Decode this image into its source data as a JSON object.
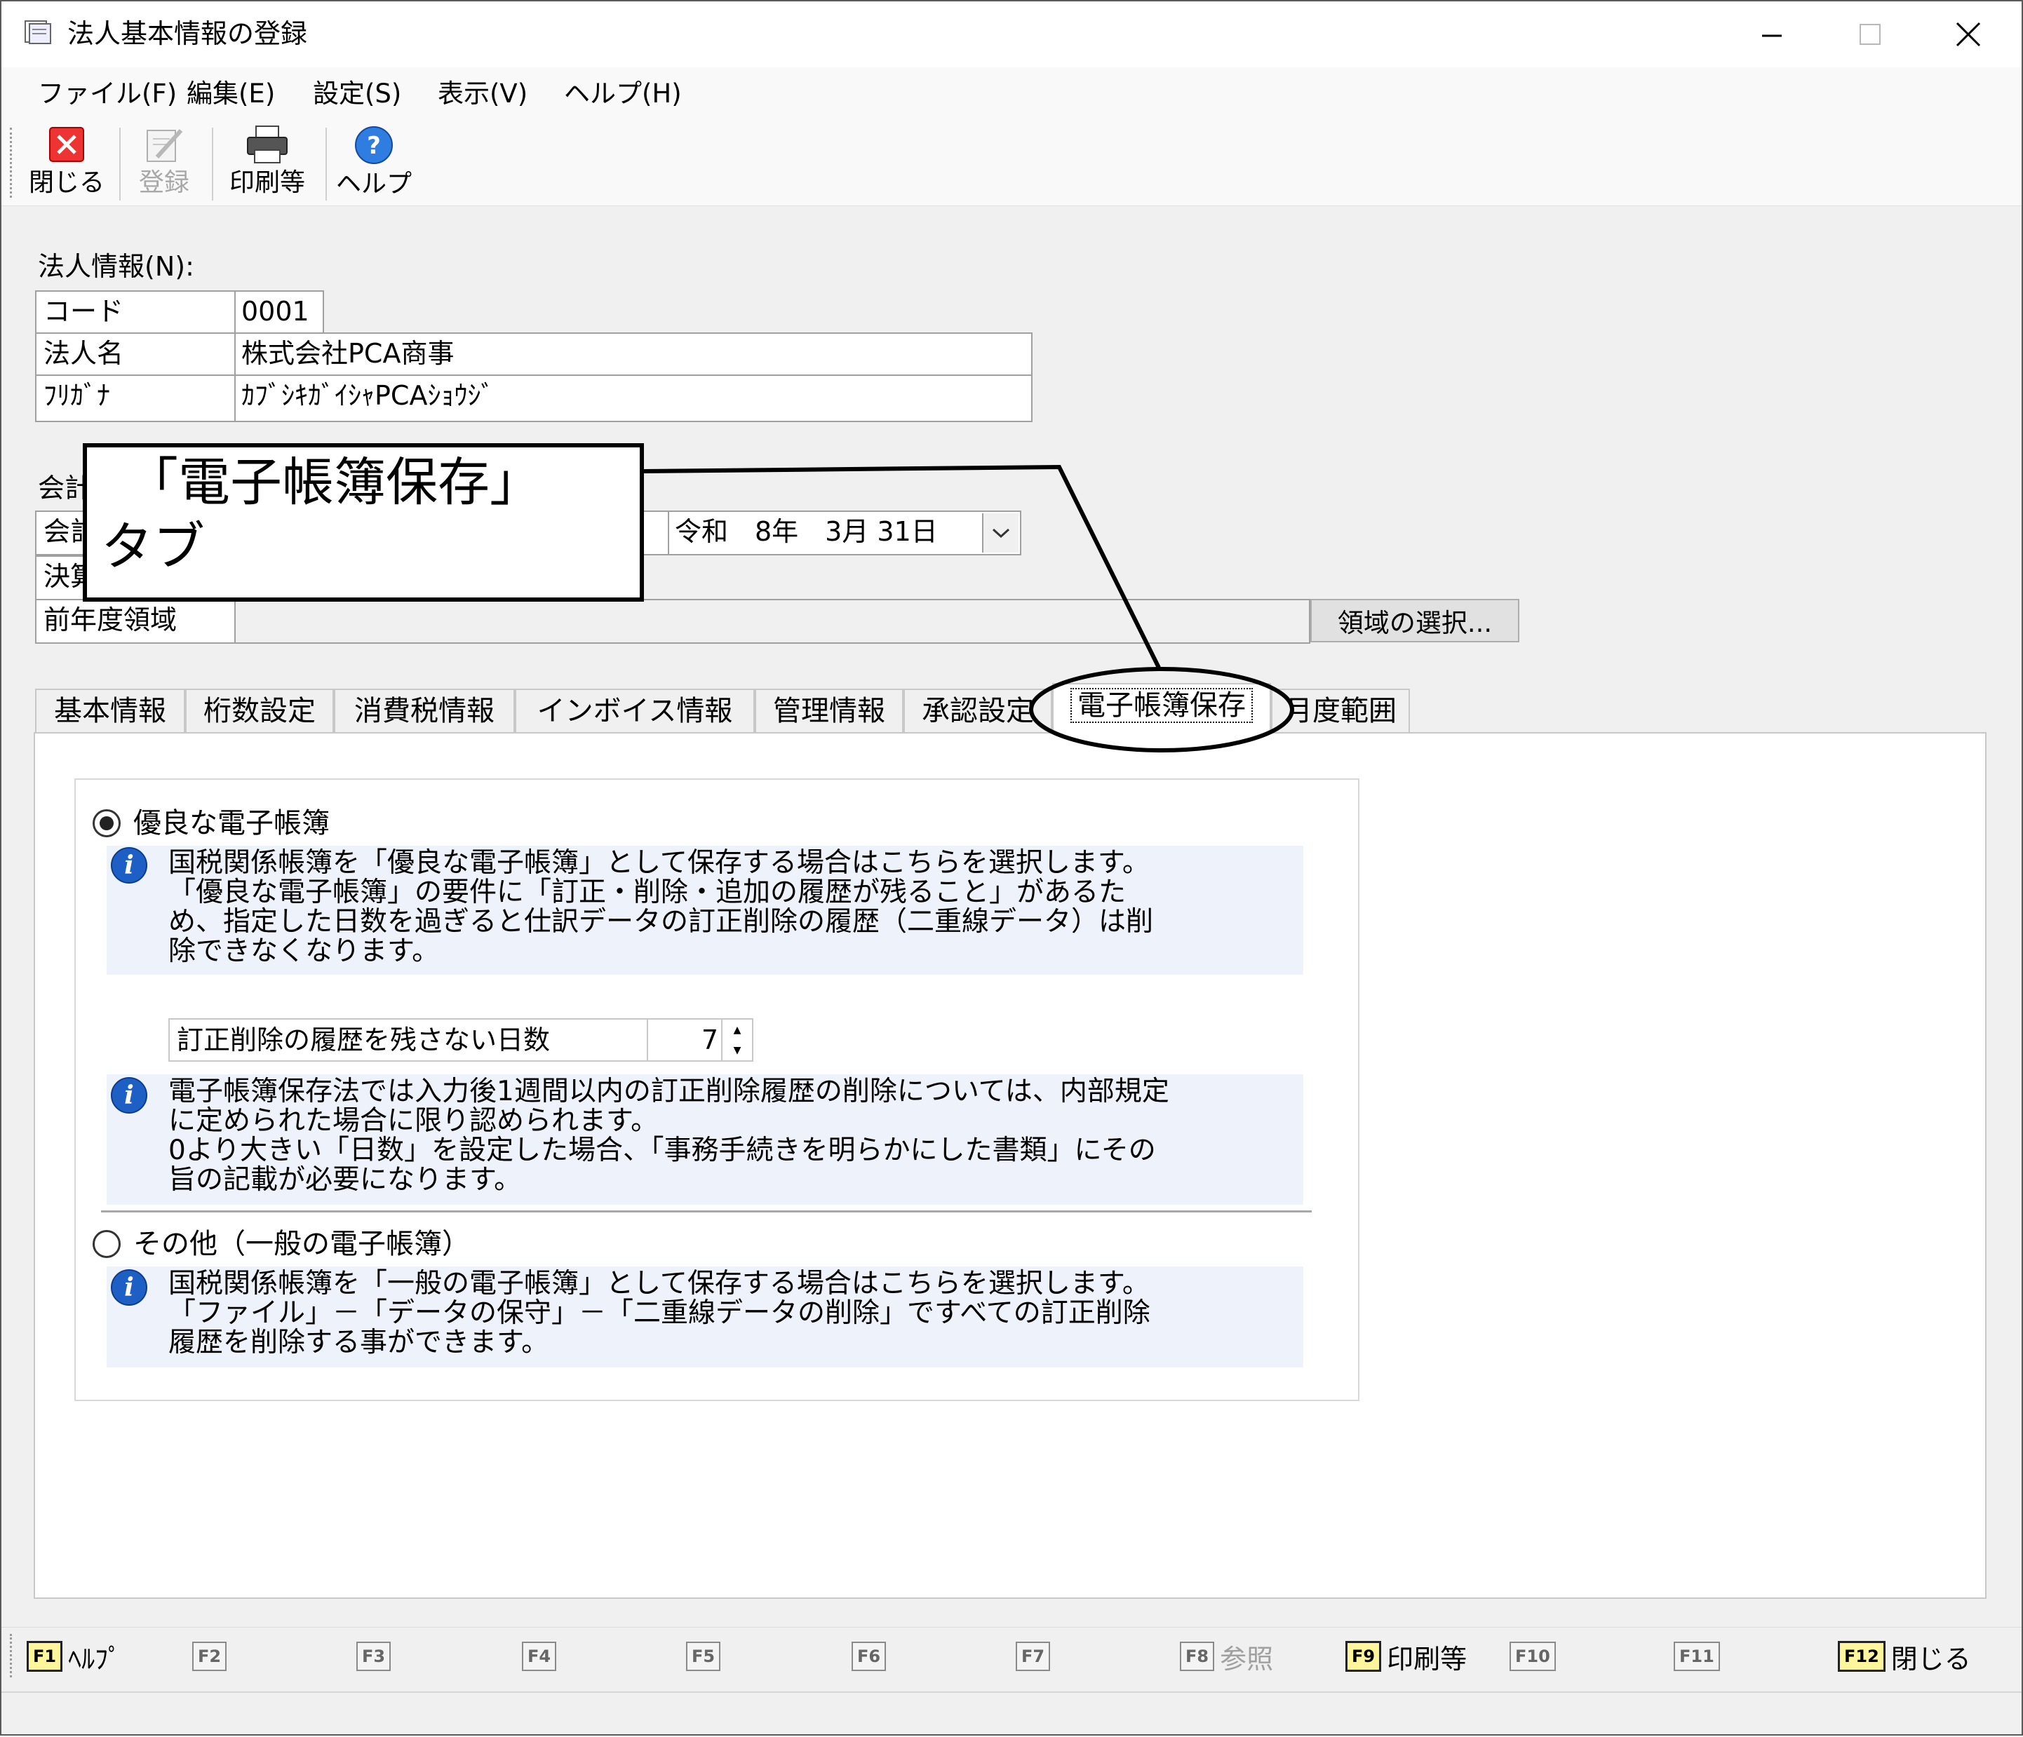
{
  "window": {
    "title": "法人基本情報の登録"
  },
  "menu": [
    "ファイル(F)",
    "編集(E)",
    "設定(S)",
    "表示(V)",
    "ヘルプ(H)"
  ],
  "toolbar": {
    "close": "閉じる",
    "register": "登録",
    "print": "印刷等",
    "help": "ヘルプ"
  },
  "corp": {
    "section_label": "法人情報(N):",
    "code_label": "コード",
    "code": "0001",
    "name_label": "法人名",
    "name": "株式会社PCA商事",
    "kana_label": "ﾌﾘｶﾞﾅ",
    "kana": "ｶﾌﾞｼｷｶﾞｲｼｬPCAｼｮｳｼﾞ"
  },
  "period": {
    "section_label_partial": "会計",
    "row1_label_partial": "会計",
    "row2_label_partial": "決算",
    "end_date": "令和　8年　3月 31日",
    "prev_label": "前年度領域",
    "prev_value": "",
    "select_button": "領域の選択..."
  },
  "callout": {
    "line1": "「電子帳簿保存」",
    "line2": "タブ"
  },
  "tabs": [
    "基本情報",
    "桁数設定",
    "消費税情報",
    "インボイス情報",
    "管理情報",
    "承認設定",
    "電子帳簿保存",
    "月度範囲"
  ],
  "active_tab": "電子帳簿保存",
  "ebook": {
    "option1_label": "優良な電子帳簿",
    "option1_selected": true,
    "info1": "国税関係帳簿を「優良な電子帳簿」として保存する場合はこちらを選択します。\n「優良な電子帳簿」の要件に「訂正・削除・追加の履歴が残ること」があるた\nめ、指定した日数を過ぎると仕訳データの訂正削除の履歴（二重線データ）は削\n除できなくなります。",
    "days_label": "訂正削除の履歴を残さない日数",
    "days_value": "7",
    "info2": "電子帳簿保存法では入力後1週間以内の訂正削除履歴の削除については、内部規定\nに定められた場合に限り認められます。\n0より大きい「日数」を設定した場合、「事務手続きを明らかにした書類」にその\n旨の記載が必要になります。",
    "option2_label": "その他（一般の電子帳簿）",
    "option2_selected": false,
    "info3": "国税関係帳簿を「一般の電子帳簿」として保存する場合はこちらを選択します。\n「ファイル」－「データの保守」－「二重線データの削除」ですべての訂正削除\n履歴を削除する事ができます。"
  },
  "fkeys": [
    {
      "key": "F1",
      "label": "ﾍﾙﾌﾟ",
      "enabled": true
    },
    {
      "key": "F2",
      "label": "",
      "enabled": false
    },
    {
      "key": "F3",
      "label": "",
      "enabled": false
    },
    {
      "key": "F4",
      "label": "",
      "enabled": false
    },
    {
      "key": "F5",
      "label": "",
      "enabled": false
    },
    {
      "key": "F6",
      "label": "",
      "enabled": false
    },
    {
      "key": "F7",
      "label": "",
      "enabled": false
    },
    {
      "key": "F8",
      "label": "参照",
      "enabled": false
    },
    {
      "key": "F9",
      "label": "印刷等",
      "enabled": true
    },
    {
      "key": "F10",
      "label": "",
      "enabled": false
    },
    {
      "key": "F11",
      "label": "",
      "enabled": false
    },
    {
      "key": "F12",
      "label": "閉じる",
      "enabled": true
    }
  ]
}
